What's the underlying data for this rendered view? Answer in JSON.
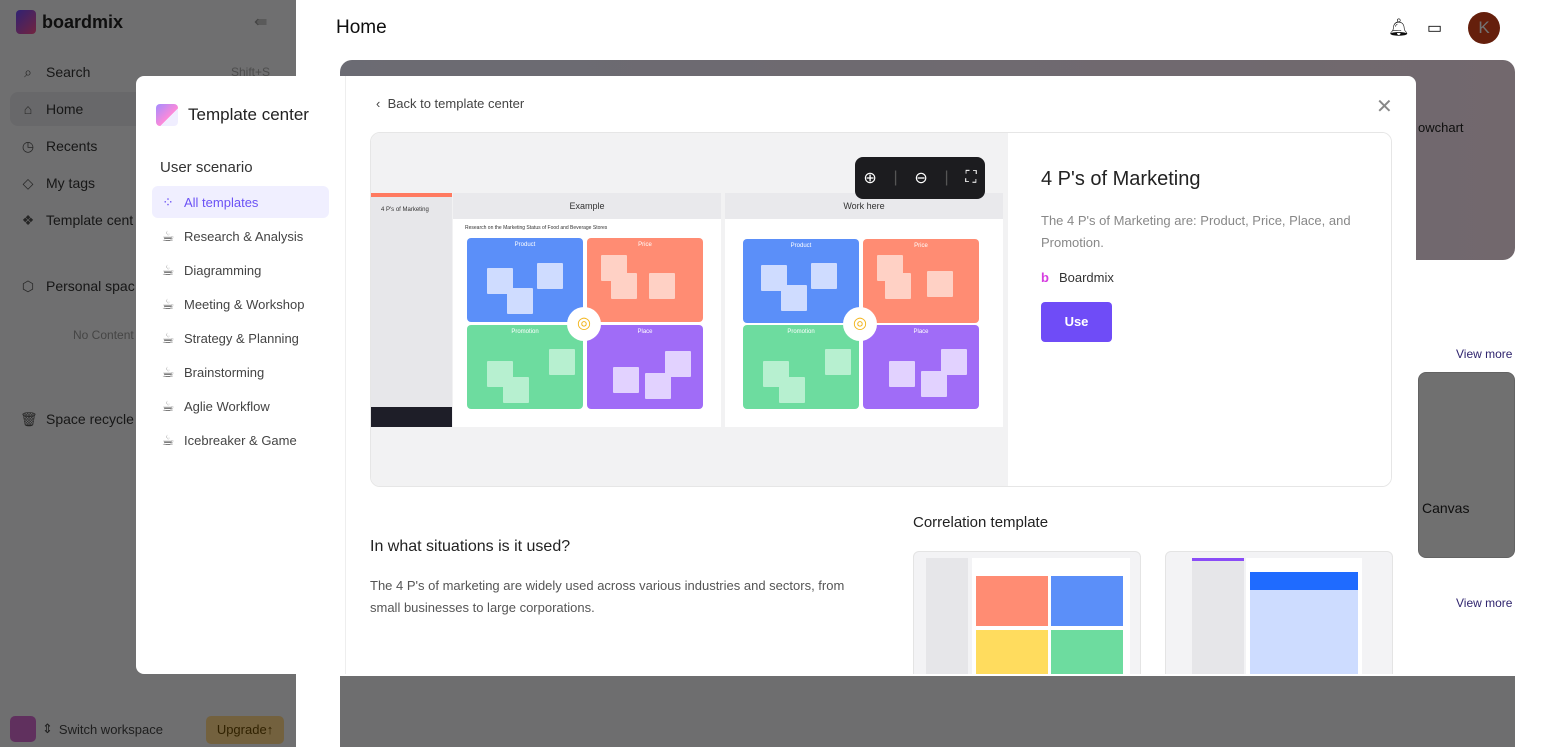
{
  "app": {
    "brand": "boardmix",
    "page_title": "Home",
    "search_shortcut": "Shift+S",
    "avatar_letter": "K"
  },
  "sidebar": {
    "items": [
      {
        "label": "Search",
        "icon": "search-icon"
      },
      {
        "label": "Home",
        "icon": "home-icon"
      },
      {
        "label": "Recents",
        "icon": "clock-icon"
      },
      {
        "label": "My tags",
        "icon": "tag-icon"
      },
      {
        "label": "Template cent",
        "icon": "template-icon"
      }
    ],
    "personal_space": "Personal spac",
    "no_content": "No Content",
    "recycle": "Space recycle",
    "switch_workspace": "Switch workspace",
    "upgrade": "Upgrade"
  },
  "background": {
    "flowchart": "owchart",
    "canvas": "Canvas",
    "view_more_1": "View more",
    "view_more_2": "View more"
  },
  "modal": {
    "title": "Template center",
    "scenario_heading": "User scenario",
    "categories": [
      {
        "label": "All templates",
        "active": true
      },
      {
        "label": "Research & Analysis"
      },
      {
        "label": "Diagramming"
      },
      {
        "label": "Meeting & Workshop"
      },
      {
        "label": "Strategy & Planning"
      },
      {
        "label": "Brainstorming"
      },
      {
        "label": "Aglie Workflow"
      },
      {
        "label": "Icebreaker & Game"
      }
    ],
    "back_label": "Back to template center",
    "preview": {
      "doc_title": "4 P's of Marketing",
      "example": "Example",
      "work_here": "Work here",
      "subtitle": "Research on the Marketing Status of Food and Beverage Stores",
      "quadrants": [
        "Product",
        "Price",
        "Promotion",
        "Place"
      ]
    },
    "template": {
      "name": "4 P's of Marketing",
      "description": "The 4 P's of Marketing are: Product, Price, Place, and Promotion.",
      "author": "Boardmix",
      "use_label": "Use"
    },
    "situations_heading": "In what situations is it used?",
    "situations_text": "The 4 P's of marketing are widely used across various industries and sectors, from small businesses to large corporations.",
    "correlation_heading": "Correlation template",
    "colors": {
      "accent": "#6f4cf7",
      "product": "#5b8ff9",
      "price": "#ff8c73",
      "promotion": "#6ddc9f",
      "place": "#a06cf7"
    }
  }
}
